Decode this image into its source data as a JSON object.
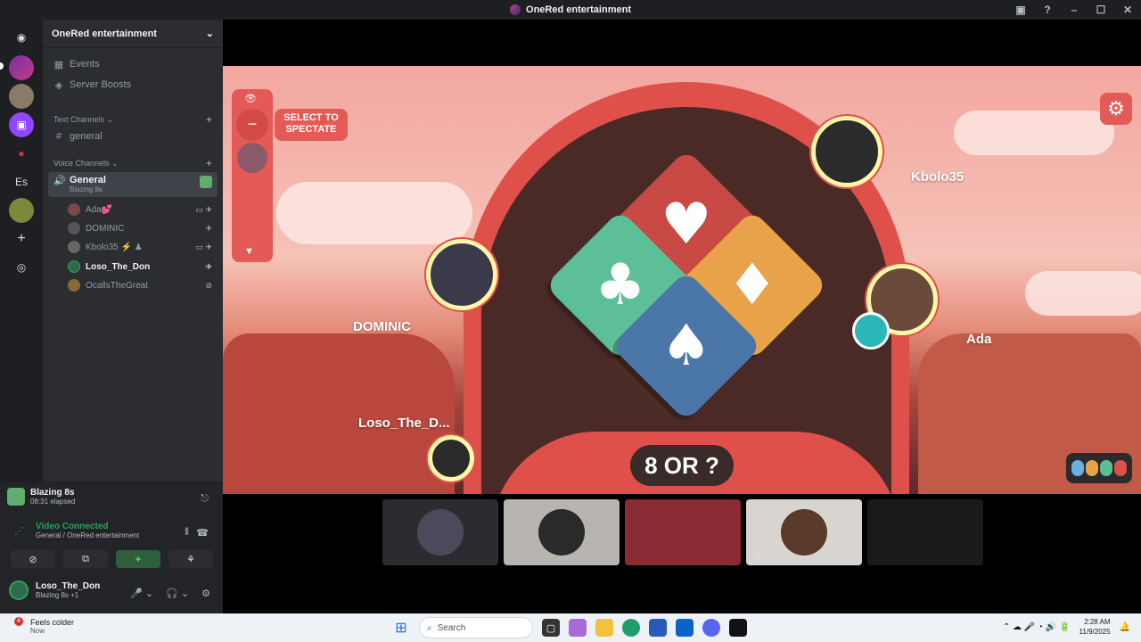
{
  "window": {
    "title": "OneRed entertainment",
    "controls": [
      "▣",
      "?",
      "–",
      "☐",
      "✕"
    ]
  },
  "guilds": [
    {
      "name": "discord-home-icon",
      "glyph": "◉"
    },
    {
      "name": "guild-1",
      "glyph": ""
    },
    {
      "name": "guild-2",
      "glyph": ""
    },
    {
      "name": "twitch-guild",
      "glyph": "▣"
    },
    {
      "name": "guild-4",
      "glyph": "●"
    },
    {
      "name": "es-guild",
      "glyph": "Es"
    },
    {
      "name": "guild-6",
      "glyph": ""
    },
    {
      "name": "add-server",
      "glyph": "+"
    },
    {
      "name": "discover",
      "glyph": "◎"
    }
  ],
  "server": {
    "name": "OneRed entertainment",
    "chevron": "⌄"
  },
  "nav": {
    "events": "Events",
    "boosts": "Server Boosts"
  },
  "text_channels": {
    "header": "Text Channels",
    "chevron": "⌄",
    "add": "+",
    "items": [
      {
        "label": "general"
      }
    ]
  },
  "voice_channels": {
    "header": "Voice Channels",
    "chevron": "⌄",
    "add": "+",
    "active": {
      "label": "General",
      "activity": "Blazing 8s"
    },
    "users": [
      {
        "name": "Ada💕",
        "icons": "▭ ✈"
      },
      {
        "name": "DOMINIC",
        "icons": "✈"
      },
      {
        "name": "Kbolo35 ⚡ ♟",
        "icons": "▭ ✈"
      },
      {
        "name": "Loso_The_Don",
        "icons": "✈"
      },
      {
        "name": "OcallsTheGreat",
        "icons": "⊘"
      }
    ]
  },
  "panel": {
    "activity_title": "Blazing 8s",
    "activity_elapsed": "08:31 elapsed",
    "voice_status": "Video Connected",
    "voice_sub": "General / OneRed entertainment",
    "buttons": [
      "⊘",
      "⧉",
      "✦",
      "⚘"
    ],
    "user": {
      "name": "Loso_The_Don",
      "status": "Blazing 8s +1"
    },
    "controls": [
      "🎤 ⌄",
      "🎧 ⌄",
      "⚙"
    ]
  },
  "game": {
    "spectate_label": "SELECT TO SPECTATE",
    "eye": "👁",
    "minus": "−",
    "down": "▼",
    "settings": "⚙",
    "center_text": "8 OR ?",
    "suits": {
      "heart": "♥",
      "club": "♣",
      "diamond": "♦",
      "spade": "♠"
    },
    "players": [
      {
        "name": "Kbolo35"
      },
      {
        "name": "DOMINIC"
      },
      {
        "name": "Ada"
      },
      {
        "name": "Loso_The_D..."
      }
    ],
    "colors": {
      "arch": "#e0504a",
      "heart": "#c94a44",
      "club": "#5cbf98",
      "diamond": "#e8a34a",
      "spade": "#4a77a8"
    }
  },
  "tiles": [
    {
      "name": "dominic-tile"
    },
    {
      "name": "loso-tile"
    },
    {
      "name": "ada-tile"
    },
    {
      "name": "ocalls-tile",
      "badge": "🎙"
    },
    {
      "name": "kbolo-tile"
    }
  ],
  "taskbar": {
    "weather": "Feels colder",
    "weather_sub": "Now",
    "badge": "4",
    "search": "Search",
    "time": "2:28 AM",
    "date": "11/9/2025",
    "tray": "⌃ ☁ 🎤 ◔ 🔊 🔋"
  }
}
